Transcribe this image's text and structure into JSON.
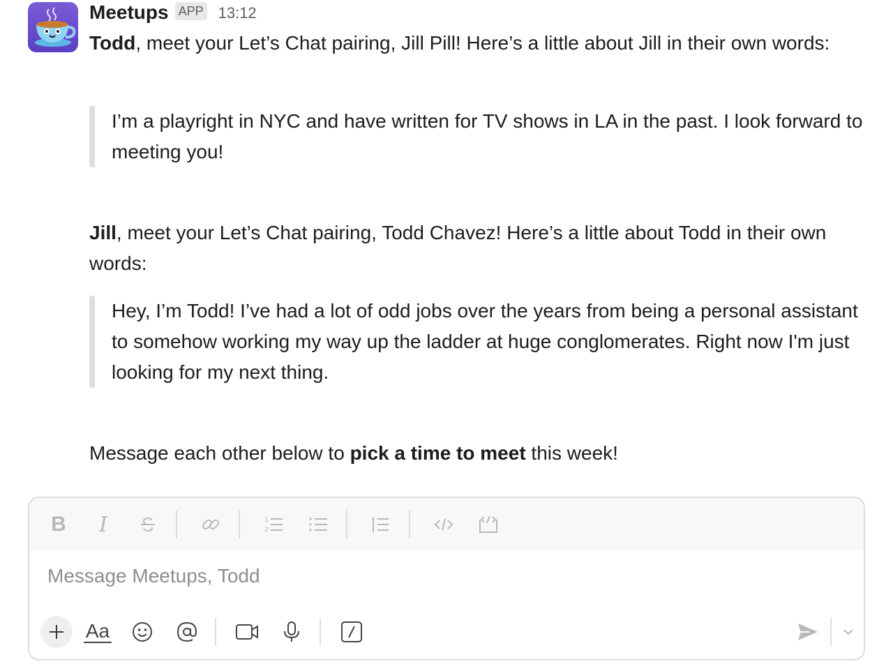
{
  "app": {
    "name": "Meetups",
    "badge": "APP",
    "timestamp": "13:12"
  },
  "message": {
    "todd_intro": {
      "name": "Todd",
      "text": ", meet your Let’s Chat pairing, Jill Pill! Here’s a little about Jill in their own words:"
    },
    "jill_quote": "I’m a playright in NYC and have written for TV shows in LA in the past. I look forward to meeting you!",
    "jill_intro": {
      "name": "Jill",
      "text": ", meet your Let’s Chat pairing, Todd Chavez! Here’s a little about Todd in their own words:"
    },
    "todd_quote": "Hey, I’m Todd! I’ve had a lot of odd jobs over the years from being a personal assistant to somehow working my way up the ladder at huge conglomerates. Right now I'm just looking for my next thing.",
    "closing": {
      "before": "Message each other below to ",
      "bold": "pick a time to meet",
      "after": " this week!"
    }
  },
  "composer": {
    "placeholder": "Message Meetups, Todd",
    "formatting_icons": [
      "bold-icon",
      "italic-icon",
      "strikethrough-icon",
      "link-icon",
      "ordered-list-icon",
      "bulleted-list-icon",
      "blockquote-icon",
      "code-icon",
      "code-block-icon"
    ],
    "bottom_icons": [
      "plus-icon",
      "text-format-icon",
      "emoji-icon",
      "mention-icon",
      "video-icon",
      "microphone-icon",
      "slash-command-icon",
      "send-icon",
      "chevron-down-icon"
    ],
    "text_format_label": "Aa",
    "bold_label": "B",
    "italic_label": "I"
  },
  "colors": {
    "avatar_bg_top": "#7b5cd6",
    "avatar_bg_bottom": "#5a3fc0",
    "text": "#1d1c1d",
    "muted": "#616061",
    "quote_bar": "#dddddd"
  }
}
